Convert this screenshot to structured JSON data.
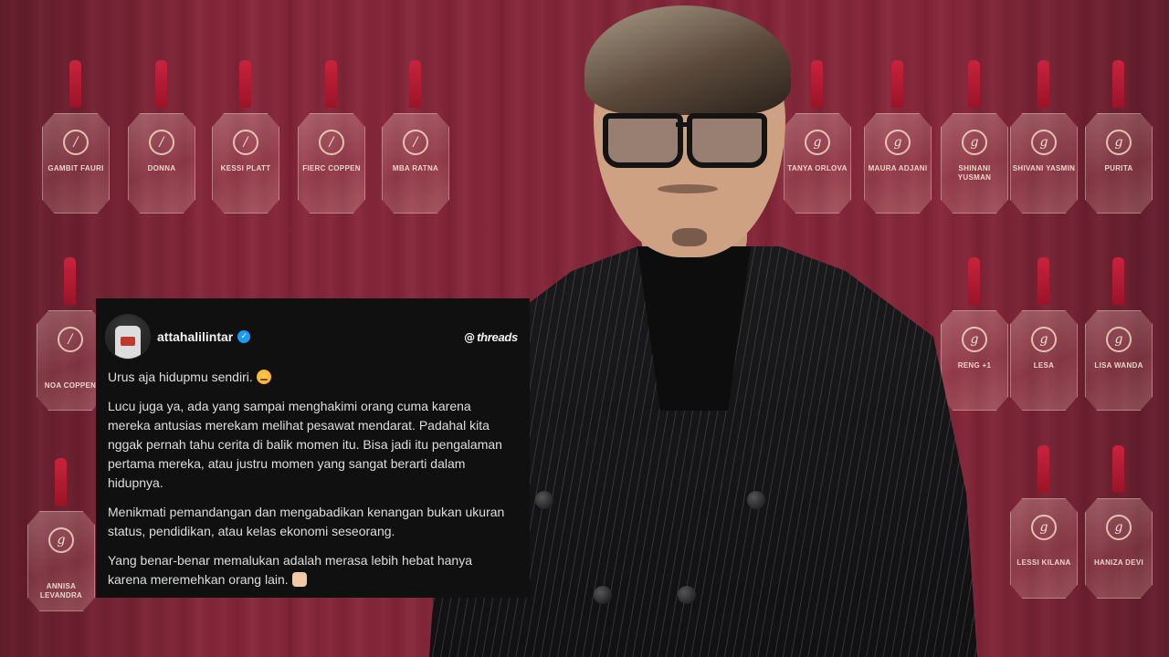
{
  "background": {
    "tags_top": [
      "GAMBIT FAURI",
      "DONNA",
      "KESSI PLATT",
      "FIERC COPPEN",
      "MBA RATNA",
      "TANYA ORLOVA",
      "MAURA ADJANI",
      "SHINANI YUSMAN",
      "SHIVANI YASMIN",
      "PURITA"
    ],
    "tags_mid": [
      "NOA COPPEN",
      "RENG +1",
      "LESA",
      "LISA WANDA"
    ],
    "tags_low": [
      "ANNISA LEVANDRA",
      "LESSI KILANA",
      "HANIZA DEVI"
    ]
  },
  "post": {
    "username": "attahalilintar",
    "verified_glyph": "✓",
    "brand_glyph": "@",
    "brand_name": "threads",
    "paragraphs": [
      "Urus aja hidupmu sendiri.",
      "Lucu juga ya, ada yang sampai menghakimi orang cuma karena mereka antusias merekam melihat pesawat mendarat. Padahal kita nggak pernah tahu cerita di balik momen itu. Bisa jadi itu pengalaman pertama mereka, atau justru momen yang sangat berarti dalam hidupnya.",
      "Menikmati pemandangan dan mengabadikan kenangan bukan ukuran status, pendidikan, atau kelas ekonomi seseorang.",
      "Yang benar-benar memalukan adalah merasa lebih hebat hanya karena meremehkan orang lain."
    ]
  }
}
